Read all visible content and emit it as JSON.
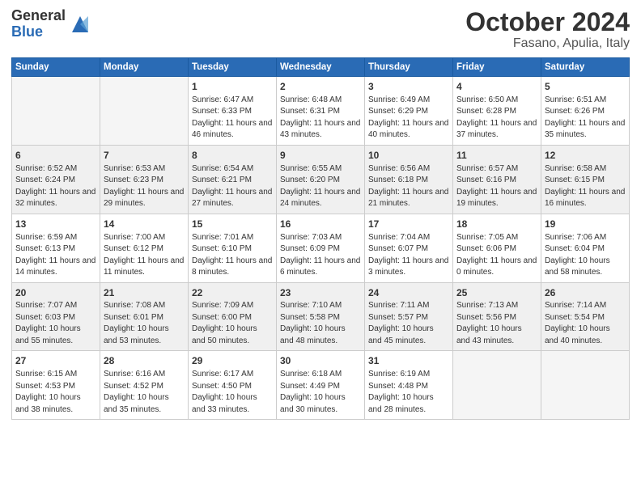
{
  "logo": {
    "general": "General",
    "blue": "Blue"
  },
  "title": {
    "month": "October 2024",
    "location": "Fasano, Apulia, Italy"
  },
  "days_of_week": [
    "Sunday",
    "Monday",
    "Tuesday",
    "Wednesday",
    "Thursday",
    "Friday",
    "Saturday"
  ],
  "weeks": [
    [
      {
        "day": "",
        "info": ""
      },
      {
        "day": "",
        "info": ""
      },
      {
        "day": "1",
        "info": "Sunrise: 6:47 AM\nSunset: 6:33 PM\nDaylight: 11 hours and 46 minutes."
      },
      {
        "day": "2",
        "info": "Sunrise: 6:48 AM\nSunset: 6:31 PM\nDaylight: 11 hours and 43 minutes."
      },
      {
        "day": "3",
        "info": "Sunrise: 6:49 AM\nSunset: 6:29 PM\nDaylight: 11 hours and 40 minutes."
      },
      {
        "day": "4",
        "info": "Sunrise: 6:50 AM\nSunset: 6:28 PM\nDaylight: 11 hours and 37 minutes."
      },
      {
        "day": "5",
        "info": "Sunrise: 6:51 AM\nSunset: 6:26 PM\nDaylight: 11 hours and 35 minutes."
      }
    ],
    [
      {
        "day": "6",
        "info": "Sunrise: 6:52 AM\nSunset: 6:24 PM\nDaylight: 11 hours and 32 minutes."
      },
      {
        "day": "7",
        "info": "Sunrise: 6:53 AM\nSunset: 6:23 PM\nDaylight: 11 hours and 29 minutes."
      },
      {
        "day": "8",
        "info": "Sunrise: 6:54 AM\nSunset: 6:21 PM\nDaylight: 11 hours and 27 minutes."
      },
      {
        "day": "9",
        "info": "Sunrise: 6:55 AM\nSunset: 6:20 PM\nDaylight: 11 hours and 24 minutes."
      },
      {
        "day": "10",
        "info": "Sunrise: 6:56 AM\nSunset: 6:18 PM\nDaylight: 11 hours and 21 minutes."
      },
      {
        "day": "11",
        "info": "Sunrise: 6:57 AM\nSunset: 6:16 PM\nDaylight: 11 hours and 19 minutes."
      },
      {
        "day": "12",
        "info": "Sunrise: 6:58 AM\nSunset: 6:15 PM\nDaylight: 11 hours and 16 minutes."
      }
    ],
    [
      {
        "day": "13",
        "info": "Sunrise: 6:59 AM\nSunset: 6:13 PM\nDaylight: 11 hours and 14 minutes."
      },
      {
        "day": "14",
        "info": "Sunrise: 7:00 AM\nSunset: 6:12 PM\nDaylight: 11 hours and 11 minutes."
      },
      {
        "day": "15",
        "info": "Sunrise: 7:01 AM\nSunset: 6:10 PM\nDaylight: 11 hours and 8 minutes."
      },
      {
        "day": "16",
        "info": "Sunrise: 7:03 AM\nSunset: 6:09 PM\nDaylight: 11 hours and 6 minutes."
      },
      {
        "day": "17",
        "info": "Sunrise: 7:04 AM\nSunset: 6:07 PM\nDaylight: 11 hours and 3 minutes."
      },
      {
        "day": "18",
        "info": "Sunrise: 7:05 AM\nSunset: 6:06 PM\nDaylight: 11 hours and 0 minutes."
      },
      {
        "day": "19",
        "info": "Sunrise: 7:06 AM\nSunset: 6:04 PM\nDaylight: 10 hours and 58 minutes."
      }
    ],
    [
      {
        "day": "20",
        "info": "Sunrise: 7:07 AM\nSunset: 6:03 PM\nDaylight: 10 hours and 55 minutes."
      },
      {
        "day": "21",
        "info": "Sunrise: 7:08 AM\nSunset: 6:01 PM\nDaylight: 10 hours and 53 minutes."
      },
      {
        "day": "22",
        "info": "Sunrise: 7:09 AM\nSunset: 6:00 PM\nDaylight: 10 hours and 50 minutes."
      },
      {
        "day": "23",
        "info": "Sunrise: 7:10 AM\nSunset: 5:58 PM\nDaylight: 10 hours and 48 minutes."
      },
      {
        "day": "24",
        "info": "Sunrise: 7:11 AM\nSunset: 5:57 PM\nDaylight: 10 hours and 45 minutes."
      },
      {
        "day": "25",
        "info": "Sunrise: 7:13 AM\nSunset: 5:56 PM\nDaylight: 10 hours and 43 minutes."
      },
      {
        "day": "26",
        "info": "Sunrise: 7:14 AM\nSunset: 5:54 PM\nDaylight: 10 hours and 40 minutes."
      }
    ],
    [
      {
        "day": "27",
        "info": "Sunrise: 6:15 AM\nSunset: 4:53 PM\nDaylight: 10 hours and 38 minutes."
      },
      {
        "day": "28",
        "info": "Sunrise: 6:16 AM\nSunset: 4:52 PM\nDaylight: 10 hours and 35 minutes."
      },
      {
        "day": "29",
        "info": "Sunrise: 6:17 AM\nSunset: 4:50 PM\nDaylight: 10 hours and 33 minutes."
      },
      {
        "day": "30",
        "info": "Sunrise: 6:18 AM\nSunset: 4:49 PM\nDaylight: 10 hours and 30 minutes."
      },
      {
        "day": "31",
        "info": "Sunrise: 6:19 AM\nSunset: 4:48 PM\nDaylight: 10 hours and 28 minutes."
      },
      {
        "day": "",
        "info": ""
      },
      {
        "day": "",
        "info": ""
      }
    ]
  ]
}
